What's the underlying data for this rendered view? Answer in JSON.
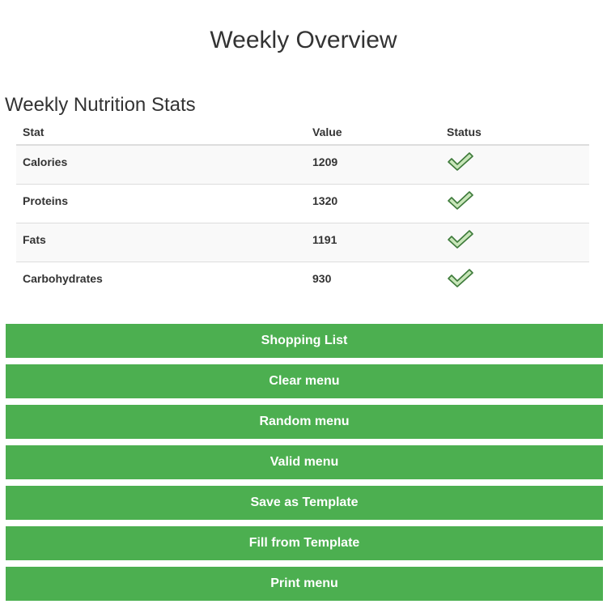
{
  "page": {
    "title": "Weekly Overview"
  },
  "nutrition": {
    "section_title": "Weekly Nutrition Stats",
    "columns": {
      "stat": "Stat",
      "value": "Value",
      "status": "Status"
    },
    "rows": [
      {
        "stat": "Calories",
        "value": "1209",
        "status_icon": "check-icon"
      },
      {
        "stat": "Proteins",
        "value": "1320",
        "status_icon": "check-icon"
      },
      {
        "stat": "Fats",
        "value": "1191",
        "status_icon": "check-icon"
      },
      {
        "stat": "Carbohydrates",
        "value": "930",
        "status_icon": "check-icon"
      }
    ]
  },
  "actions": {
    "shopping_list": "Shopping List",
    "clear_menu": "Clear menu",
    "random_menu": "Random menu",
    "valid_menu": "Valid menu",
    "save_template": "Save as Template",
    "fill_template": "Fill from Template",
    "print_menu": "Print menu"
  },
  "colors": {
    "button_bg": "#4caf50",
    "button_text": "#ffffff",
    "check_fill": "#c8e6b9",
    "check_stroke": "#3d7a3a"
  }
}
